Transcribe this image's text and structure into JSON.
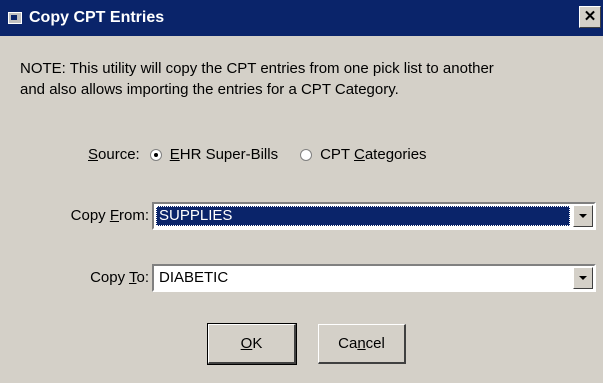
{
  "window": {
    "title": "Copy CPT Entries",
    "close_glyph": "✕"
  },
  "note": {
    "line1": "NOTE: This utility will copy the CPT entries from one pick list to another",
    "line2": "and also allows importing the entries for a CPT Category."
  },
  "source": {
    "label_pre": "",
    "label_ul": "S",
    "label_post": "ource:",
    "options": [
      {
        "pre": "",
        "ul": "E",
        "post": "HR Super-Bills",
        "checked": true
      },
      {
        "pre": "CPT ",
        "ul": "C",
        "post": "ategories",
        "checked": false
      }
    ]
  },
  "copy_from": {
    "label_pre": "Copy ",
    "label_ul": "F",
    "label_post": "rom:",
    "value": "SUPPLIES"
  },
  "copy_to": {
    "label_pre": "Copy ",
    "label_ul": "T",
    "label_post": "o:",
    "value": "DIABETIC"
  },
  "buttons": {
    "ok": {
      "pre": "",
      "ul": "O",
      "post": "K"
    },
    "cancel": {
      "pre": "Ca",
      "ul": "n",
      "post": "cel"
    }
  },
  "icons": {
    "app": "app-icon",
    "close": "close-icon",
    "dropdown": "chevron-down-icon"
  }
}
